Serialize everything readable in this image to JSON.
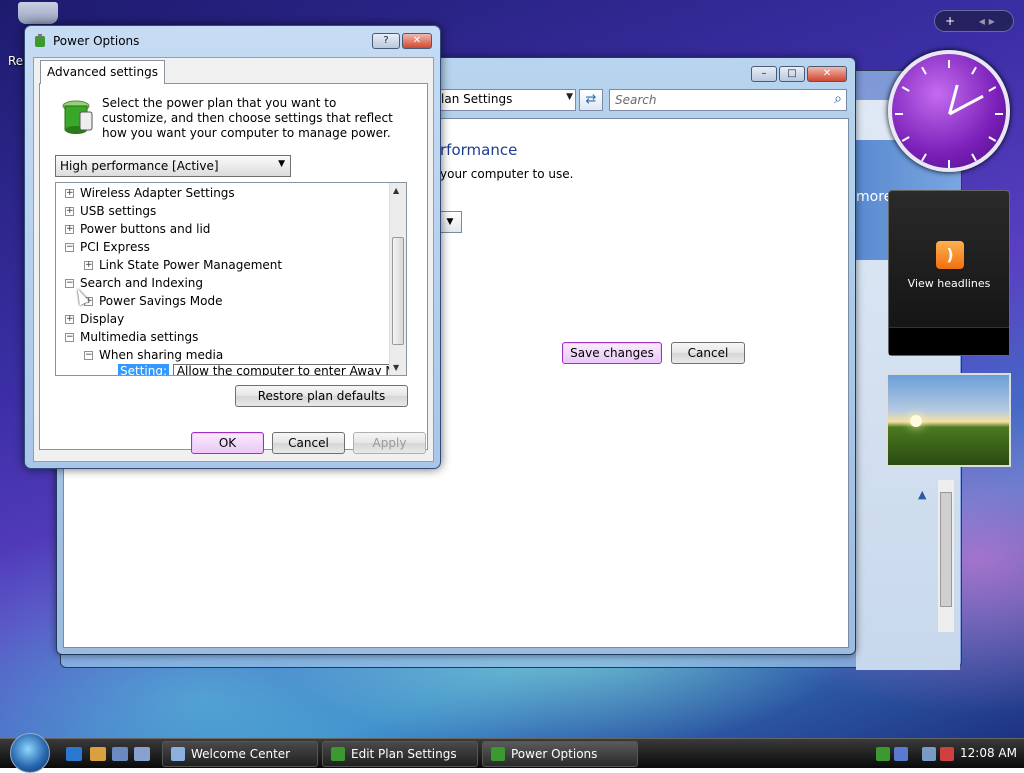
{
  "desktop": {
    "label_partial": "Re"
  },
  "edit_plan_window": {
    "address_partial": "lan Settings",
    "search_placeholder": "Search",
    "heading_partial": "rformance",
    "subtext_partial": "your computer to use.",
    "save_label": "Save changes",
    "cancel_label": "Cancel",
    "more_partial": "more"
  },
  "dialog": {
    "title": "Power Options",
    "help_button": "?",
    "close_button": "✕",
    "tab_label": "Advanced settings",
    "intro_text": "Select the power plan that you want to customize, and then choose settings that reflect how you want your computer to manage power.",
    "plan_selected": "High performance [Active]",
    "tree": [
      {
        "label": "Wireless Adapter Settings",
        "expanded": false,
        "level": 0
      },
      {
        "label": "USB settings",
        "expanded": false,
        "level": 0
      },
      {
        "label": "Power buttons and lid",
        "expanded": false,
        "level": 0
      },
      {
        "label": "PCI Express",
        "expanded": true,
        "level": 0
      },
      {
        "label": "Link State Power Management",
        "expanded": false,
        "level": 1
      },
      {
        "label": "Search and Indexing",
        "expanded": true,
        "level": 0
      },
      {
        "label": "Power Savings Mode",
        "expanded": false,
        "level": 1
      },
      {
        "label": "Display",
        "expanded": false,
        "level": 0
      },
      {
        "label": "Multimedia settings",
        "expanded": true,
        "level": 0
      },
      {
        "label": "When sharing media",
        "expanded": true,
        "level": 1
      }
    ],
    "setting_label": "Setting:",
    "setting_value": "Allow the computer to enter Away Mo",
    "restore_label": "Restore plan defaults",
    "ok_label": "OK",
    "cancel_label": "Cancel",
    "apply_label": "Apply"
  },
  "gadgets": {
    "sidebar_add": "+",
    "feed_label": "View headlines"
  },
  "taskbar": {
    "tasks": [
      {
        "label": "Welcome Center"
      },
      {
        "label": "Edit Plan Settings"
      },
      {
        "label": "Power Options"
      }
    ],
    "time": "12:08 AM"
  },
  "colors": {
    "accent": "#3399ff",
    "heading": "#1e3c8c",
    "clock_face": "#7a1fb8"
  }
}
